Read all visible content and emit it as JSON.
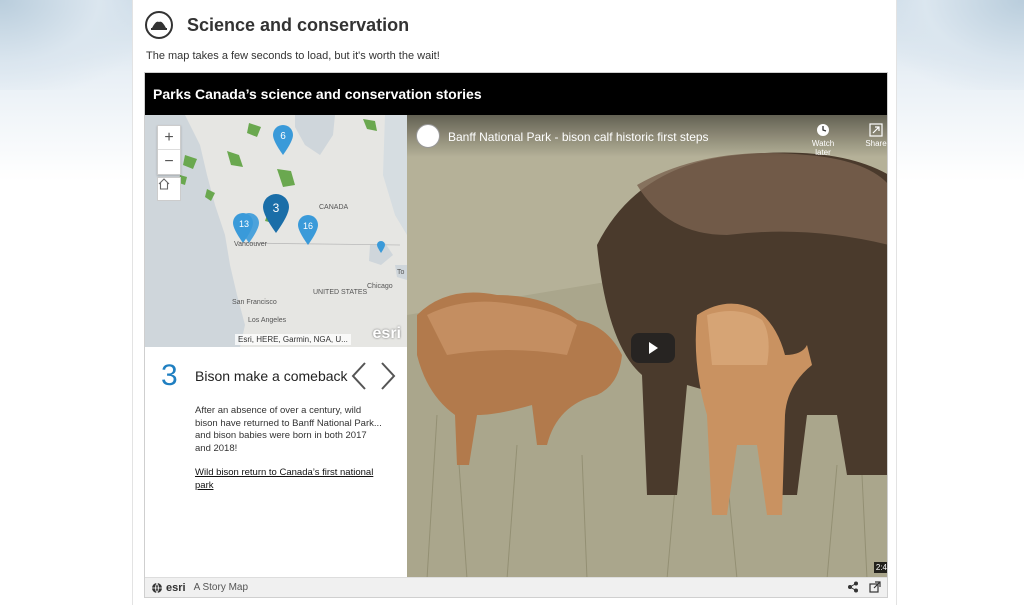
{
  "header": {
    "title": "Science and conservation",
    "intro": "The map takes a few seconds to load, but it's worth the wait!"
  },
  "story": {
    "title": "Parks Canada’s science and conservation stories",
    "map": {
      "zoom_in": "+",
      "zoom_out": "−",
      "clusters": [
        "6",
        "3",
        "13",
        "16"
      ],
      "labels": {
        "canada": "CANADA",
        "united_states": "UNITED STATES",
        "vancouver": "Vancouver",
        "san_francisco": "San Francisco",
        "los_angeles": "Los Angeles",
        "chicago": "Chicago",
        "toronto": "To"
      },
      "attribution": "Esri, HERE, Garmin, NGA, U...",
      "logo": "esri"
    },
    "entry": {
      "number": "3",
      "heading": "Bison make a comeback",
      "text": "After an absence of over a century, wild bison have returned to Banff National Park... and bison babies were born in both 2017 and 2018!",
      "link": "Wild bison return to Canada’s first national park"
    },
    "video": {
      "title": "Banff National Park - bison calf historic first steps",
      "watch_later": "Watch later",
      "share": "Share",
      "duration": "2:4"
    },
    "footer": {
      "brand": "esri",
      "label": "A Story Map"
    }
  },
  "icons": [
    "parks-canada-logo-icon",
    "home-icon",
    "chevron-left-icon",
    "chevron-right-icon",
    "clock-icon",
    "share-icon",
    "play-icon",
    "external-link-icon"
  ],
  "colors": {
    "accent": "#1f7fc1",
    "story_header": "#000000",
    "map_marker": "#3a9ad9",
    "parks_green": "#6aa84f"
  }
}
